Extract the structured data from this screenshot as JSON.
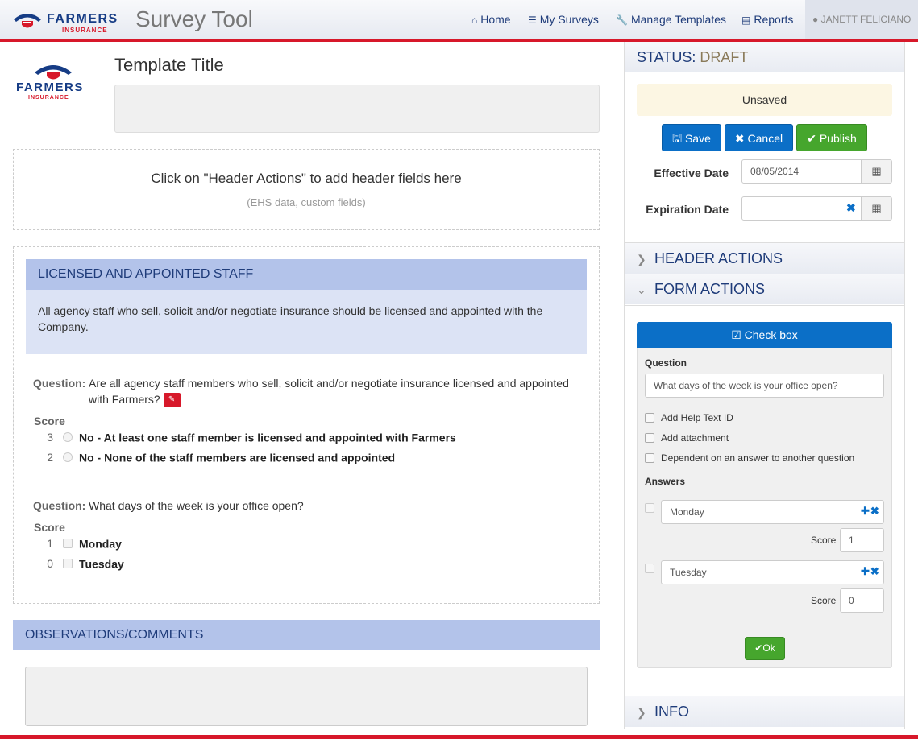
{
  "brand": {
    "name": "FARMERS",
    "sub": "INSURANCE",
    "red": "#d7182a",
    "navy": "#163c85"
  },
  "app_title": "Survey Tool",
  "nav": {
    "home": "Home",
    "my_surveys": "My Surveys",
    "manage_templates": "Manage Templates",
    "reports": "Reports",
    "user": "JANETT FELICIANO"
  },
  "template": {
    "title": "Template Title",
    "header_drop_main": "Click on \"Header Actions\" to add header fields here",
    "header_drop_hint": "(EHS data, custom fields)"
  },
  "section": {
    "title": "LICENSED AND APPOINTED STAFF",
    "description": "All agency staff who sell, solicit and/or negotiate insurance should be licensed and appointed with the Company."
  },
  "questions": [
    {
      "label": "Question:",
      "text": "Are all agency staff members who sell, solicit and/or negotiate insurance licensed and appointed with Farmers?",
      "score_label": "Score",
      "options": [
        {
          "score": "3",
          "label": "No - At least one staff member is licensed and appointed with Farmers"
        },
        {
          "score": "2",
          "label": "No - None of the staff members are licensed and appointed"
        }
      ]
    },
    {
      "label": "Question:",
      "text": "What days of the week is your office open?",
      "score_label": "Score",
      "options": [
        {
          "score": "1",
          "label": "Monday"
        },
        {
          "score": "0",
          "label": "Tuesday"
        }
      ]
    }
  ],
  "observations": {
    "title": "OBSERVATIONS/COMMENTS"
  },
  "status": {
    "label": "STATUS:",
    "value": "DRAFT",
    "save_state": "Unsaved",
    "save": "Save",
    "cancel": "Cancel",
    "publish": "Publish",
    "effective_label": "Effective Date",
    "effective_value": "08/05/2014",
    "expiration_label": "Expiration Date",
    "expiration_value": ""
  },
  "panels": {
    "header_actions": "HEADER ACTIONS",
    "form_actions": "FORM ACTIONS",
    "info": "INFO"
  },
  "form_editor": {
    "type": "Check box",
    "question_label": "Question",
    "question_value": "What days of the week is your office open?",
    "opt_help": "Add Help Text ID",
    "opt_attachment": "Add attachment",
    "opt_dependent": "Dependent on an answer to another question",
    "answers_label": "Answers",
    "answers": [
      {
        "value": "Monday",
        "score_label": "Score",
        "score": "1"
      },
      {
        "value": "Tuesday",
        "score_label": "Score",
        "score": "0"
      }
    ],
    "ok": "Ok"
  },
  "colors": {
    "accent": "#0b6fc7",
    "green": "#46a62d",
    "section_head": "#b3c3ea",
    "section_body": "#dce3f5",
    "unsaved_bg": "#fcf6e3"
  }
}
